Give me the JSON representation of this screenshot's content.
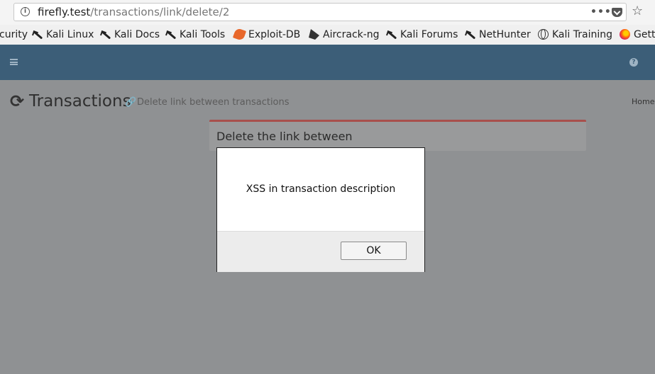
{
  "browser": {
    "url_host": "firefly.test",
    "url_path": "/transactions/link/delete/2",
    "more_glyph": "•••",
    "star_glyph": "☆",
    "bookmarks": [
      {
        "label": "curity",
        "icon": "none"
      },
      {
        "label": "Kali Linux",
        "icon": "kali-dragon-icon"
      },
      {
        "label": "Kali Docs",
        "icon": "kali-dragon-icon"
      },
      {
        "label": "Kali Tools",
        "icon": "kali-dragon-icon"
      },
      {
        "label": "Exploit-DB",
        "icon": "exploit-db-icon"
      },
      {
        "label": "Aircrack-ng",
        "icon": "aircrack-icon"
      },
      {
        "label": "Kali Forums",
        "icon": "kali-dragon-icon"
      },
      {
        "label": "NetHunter",
        "icon": "kali-dragon-icon"
      },
      {
        "label": "Kali Training",
        "icon": "globe-icon"
      },
      {
        "label": "Gett",
        "icon": "firefox-icon"
      }
    ]
  },
  "app": {
    "header_color": "#3c5e78",
    "help_glyph": "?",
    "refresh_glyph": "⟳",
    "link_glyph": "🔗",
    "page_title": "Transactions",
    "page_subtitle": "Delete link between transactions",
    "breadcrumb": "Home",
    "box_title": "Delete the link between",
    "box_accent": "#a8504c"
  },
  "dialog": {
    "message": "XSS in transaction description",
    "ok_label": "OK"
  }
}
